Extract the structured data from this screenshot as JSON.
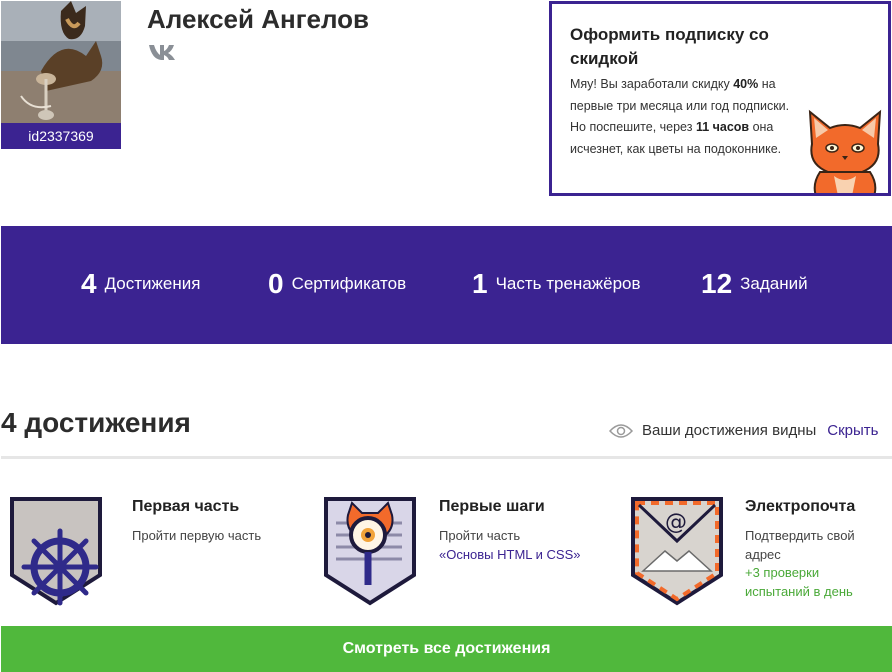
{
  "user": {
    "id_label": "id2337369",
    "name": "Алексей Ангелов",
    "social_icon": "vk-icon"
  },
  "promo": {
    "title": "Оформить подписку со скидкой",
    "text_1": "Мяу! Вы заработали скидку ",
    "discount": "40%",
    "text_2": " на первые три месяца или год подписки. Но поспешите, через ",
    "hours": "11 часов",
    "text_3": " она исчезнет, как цветы на подоконнике."
  },
  "stats": [
    {
      "value": "4",
      "label": "Достижения"
    },
    {
      "value": "0",
      "label": "Сертификатов"
    },
    {
      "value": "1",
      "label": "Часть тренажёров"
    },
    {
      "value": "12",
      "label": "Заданий"
    }
  ],
  "achievements": {
    "heading": "4 достижения",
    "visibility_text": "Ваши достижения видны",
    "hide_link": "Скрыть",
    "items": [
      {
        "name": "Первая часть",
        "desc": "Пройти первую часть",
        "icon": "ship-wheel-badge-icon"
      },
      {
        "name": "Первые шаги",
        "desc_prefix": "Пройти часть",
        "link": "«Основы HTML и CSS»",
        "icon": "cat-magnifier-badge-icon"
      },
      {
        "name": "Электропочта",
        "desc": "Подтвердить свой адрес",
        "bonus": "+3 проверки испытаний в день",
        "icon": "envelope-badge-icon"
      }
    ],
    "all_button": "Смотреть все достижения"
  },
  "colors": {
    "brand_purple": "#3b2391",
    "green": "#50b83c",
    "bonus_green": "#4aa938"
  }
}
